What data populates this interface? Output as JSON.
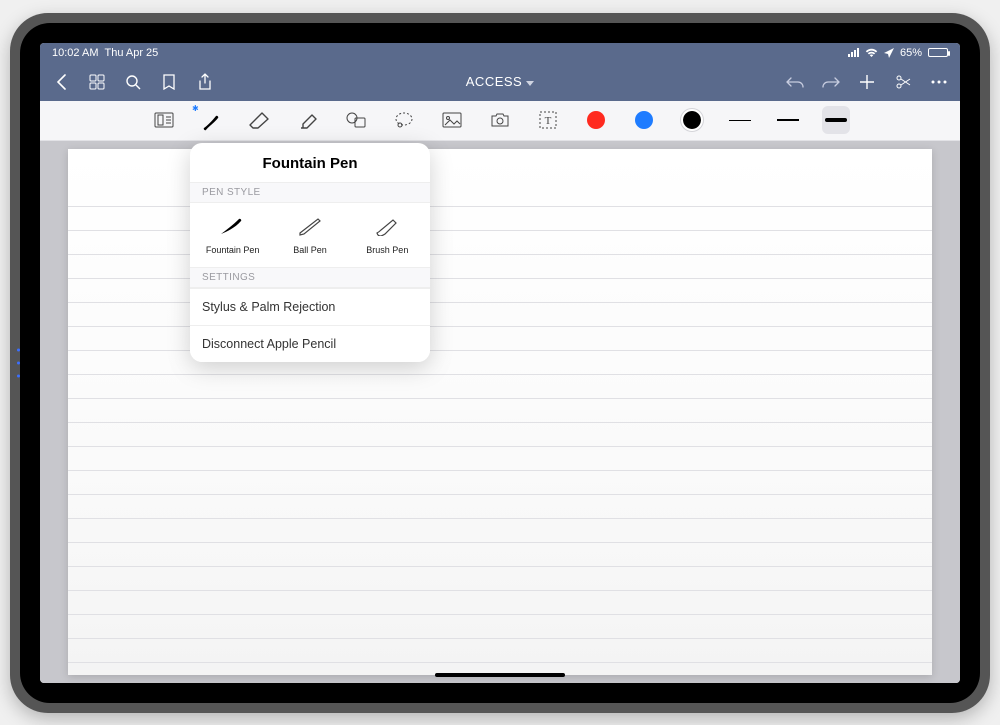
{
  "status": {
    "time": "10:02 AM",
    "date": "Thu Apr 25",
    "battery_pct": "65%"
  },
  "nav": {
    "title": "ACCESS"
  },
  "popover": {
    "title": "Fountain Pen",
    "pen_style_label": "PEN STYLE",
    "styles": {
      "fountain": "Fountain Pen",
      "ball": "Ball Pen",
      "brush": "Brush Pen"
    },
    "settings_label": "SETTINGS",
    "stylus_row": "Stylus & Palm Rejection",
    "disconnect_row": "Disconnect Apple Pencil"
  },
  "colors": {
    "navbar": "#5a6a8c",
    "red": "#ff2a1f",
    "blue": "#1f7cff",
    "black": "#000000"
  }
}
